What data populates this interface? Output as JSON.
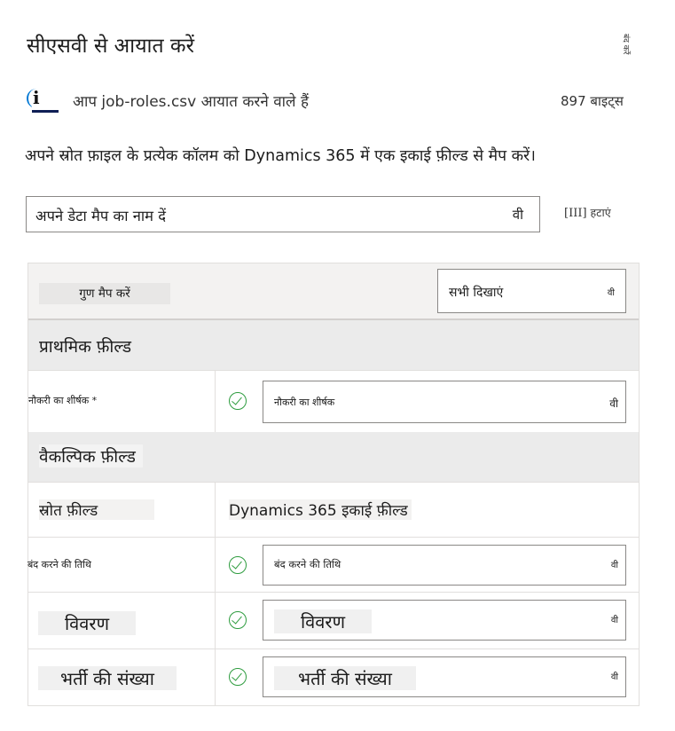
{
  "dialog": {
    "title": "सीएसवी से आयात करें",
    "close_label": "बंद करें"
  },
  "file": {
    "message": "आप job-roles.csv आयात करने वाले हैं",
    "size": "897 बाइट्स",
    "icon": "info-icon"
  },
  "instruction": "अपने स्रोत फ़ाइल के प्रत्येक कॉलम को Dynamics 365 में एक इकाई फ़ील्ड से मैप करें।",
  "data_map": {
    "name_placeholder": "अपने डेटा मैप का नाम दें",
    "chevron": "वी",
    "remove_bracket": "[III]",
    "remove_label": "हटाएं"
  },
  "mapping": {
    "map_attributes_label": "गुण मैप करें",
    "show_filter": "सभी दिखाएं",
    "filter_chevron": "वी",
    "primary_section": "प्राथमिक फ़ील्ड",
    "optional_section": "वैकल्पिक फ़ील्ड",
    "source_column_header": "स्रोत फ़ील्ड",
    "target_column_header": "Dynamics 365 इकाई फ़ील्ड",
    "primary_fields": [
      {
        "source": "नौकरी का शीर्षक *",
        "target": "नौकरी का शीर्षक",
        "chevron": "वी"
      }
    ],
    "optional_fields": [
      {
        "source": "बंद करने की तिथि",
        "target": "बंद करने की तिथि",
        "chevron": "वी"
      },
      {
        "source": "विवरण",
        "target": "विवरण",
        "chevron": "वी"
      },
      {
        "source": "भर्ती की संख्या",
        "target": "भर्ती की संख्या",
        "chevron": "वी"
      }
    ]
  },
  "colors": {
    "check": "#2e9c3f",
    "border": "#8a8886",
    "section_bg": "#ebebeb",
    "accent": "#0078d4"
  }
}
